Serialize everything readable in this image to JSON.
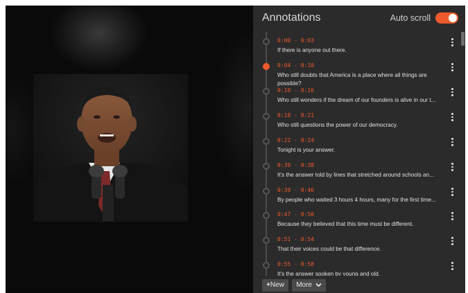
{
  "panel": {
    "title": "Annotations",
    "autoscroll_label": "Auto scroll",
    "autoscroll_on": true,
    "accent_color": "#ef5a2c"
  },
  "annotations": [
    {
      "time": "0:00 - 0:03",
      "text": "If there is anyone out there.",
      "active": false
    },
    {
      "time": "0:04 - 0:10",
      "text": "Who still doubts that America is a place where all things are possible?",
      "active": true
    },
    {
      "time": "0:10 - 0:16",
      "text": "Who still wonders if the dream of our founders is alive in our t...",
      "active": false
    },
    {
      "time": "0:18 - 0:21",
      "text": "Who still questions the power of our democracy.",
      "active": false
    },
    {
      "time": "0:22 - 0:24",
      "text": "Tonight is your answer.",
      "active": false
    },
    {
      "time": "0:30 - 0:38",
      "text": "It's the answer told by lines that stretched around schools an...",
      "active": false
    },
    {
      "time": "0:39 - 0:46",
      "text": "By people who waited 3 hours 4 hours, many for the first time...",
      "active": false
    },
    {
      "time": "0:47 - 0:50",
      "text": "Because they believed that this time must be different.",
      "active": false
    },
    {
      "time": "0:51 - 0:54",
      "text": "That their voices could be that difference.",
      "active": false
    },
    {
      "time": "0:55 - 0:58",
      "text": "It's the answer spoken by young and old.",
      "active": false
    }
  ],
  "footer": {
    "new_glyph": "+",
    "new_label": "New",
    "more_label": "More",
    "more_icon": "chevron-down-icon"
  },
  "icons": {
    "item_menu": "kebab-menu-icon"
  }
}
